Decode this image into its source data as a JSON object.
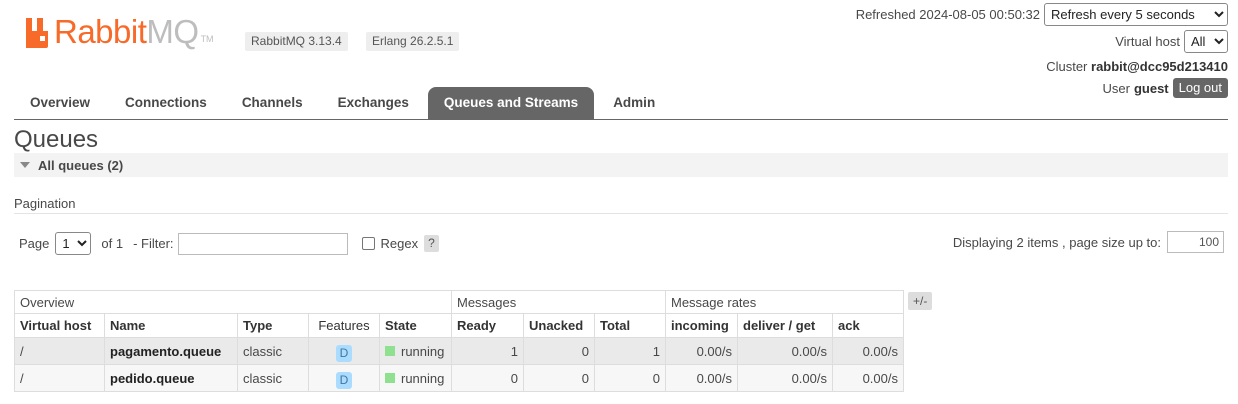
{
  "logo": {
    "rabbit": "Rabbit",
    "mq": "MQ",
    "tm": "TM"
  },
  "badges": {
    "rabbitmq_version": "RabbitMQ 3.13.4",
    "erlang_version": "Erlang 26.2.5.1"
  },
  "header": {
    "refreshed_label": "Refreshed 2024-08-05 00:50:32",
    "refresh_options": [
      "Refresh every 5 seconds"
    ],
    "refresh_selected": "Refresh every 5 seconds",
    "vhost_label": "Virtual host",
    "vhost_selected": "All",
    "cluster_label": "Cluster",
    "cluster_name": "rabbit@dcc95d213410",
    "user_label": "User",
    "user_name": "guest",
    "logout_label": "Log out"
  },
  "tabs": [
    {
      "label": "Overview",
      "active": false
    },
    {
      "label": "Connections",
      "active": false
    },
    {
      "label": "Channels",
      "active": false
    },
    {
      "label": "Exchanges",
      "active": false
    },
    {
      "label": "Queues and Streams",
      "active": true
    },
    {
      "label": "Admin",
      "active": false
    }
  ],
  "page_title": "Queues",
  "section_title": "All queues (2)",
  "pagination": {
    "label": "Pagination",
    "page_label": "Page",
    "page_selected": "1",
    "of_label": "of 1",
    "filter_label": "- Filter:",
    "filter_value": "",
    "regex_label": "Regex",
    "help_label": "?",
    "displaying_label": "Displaying 2 items , page size up to:",
    "page_size": "100"
  },
  "table": {
    "groups": [
      "Overview",
      "Messages",
      "Message rates"
    ],
    "plus_minus": "+/-",
    "columns": [
      "Virtual host",
      "Name",
      "Type",
      "Features",
      "State",
      "Ready",
      "Unacked",
      "Total",
      "incoming",
      "deliver / get",
      "ack"
    ],
    "rows": [
      {
        "vhost": "/",
        "name": "pagamento.queue",
        "type": "classic",
        "feature": "D",
        "state": "running",
        "ready": "1",
        "unacked": "0",
        "total": "1",
        "incoming": "0.00/s",
        "deliver_get": "0.00/s",
        "ack": "0.00/s"
      },
      {
        "vhost": "/",
        "name": "pedido.queue",
        "type": "classic",
        "feature": "D",
        "state": "running",
        "ready": "0",
        "unacked": "0",
        "total": "0",
        "incoming": "0.00/s",
        "deliver_get": "0.00/s",
        "ack": "0.00/s"
      }
    ]
  },
  "colors": {
    "brand": "#f76a29",
    "tab_active": "#666666",
    "state_running": "#8fe08f",
    "feature_badge": "#aadcff"
  }
}
